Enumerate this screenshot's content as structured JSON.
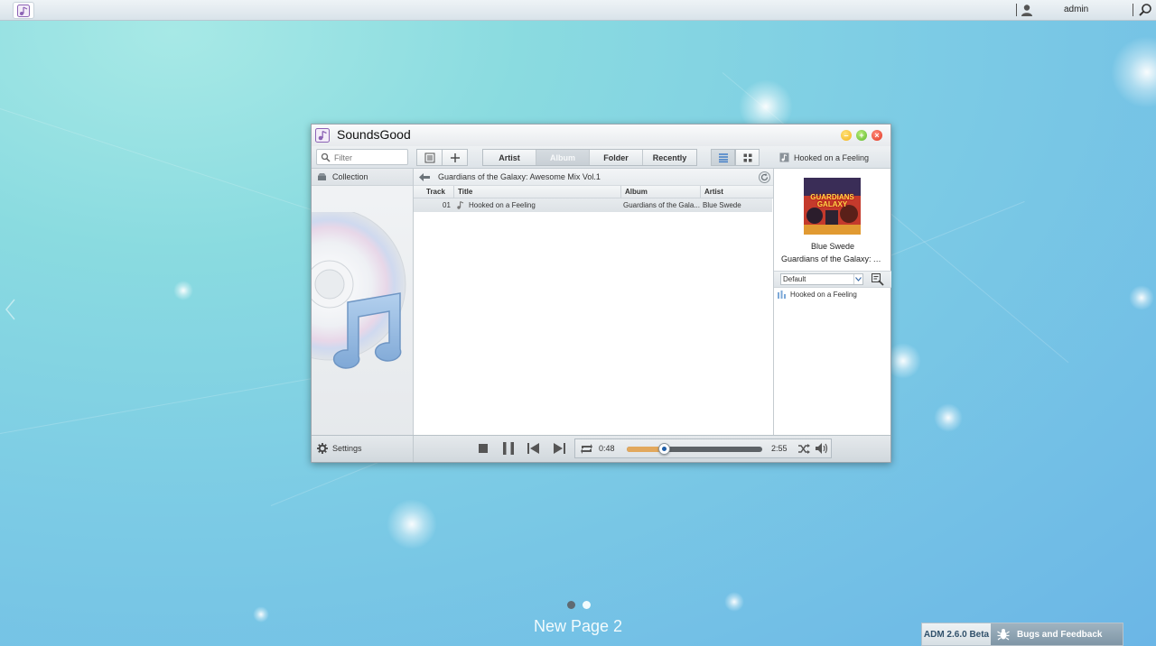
{
  "topbar": {
    "user_name": "admin"
  },
  "window": {
    "title": "SoundsGood",
    "filter_placeholder": "Filter",
    "tabs": [
      {
        "label": "Artist",
        "active": false
      },
      {
        "label": "Album",
        "active": true
      },
      {
        "label": "Folder",
        "active": false
      },
      {
        "label": "Recently",
        "active": false
      }
    ],
    "now_playing": "Hooked on a Feeling"
  },
  "sidebar": {
    "collection_label": "Collection",
    "settings_label": "Settings"
  },
  "main": {
    "breadcrumb": "Guardians of the Galaxy: Awesome Mix Vol.1",
    "columns": [
      "Track",
      "Title",
      "Album",
      "Artist"
    ],
    "rows": [
      {
        "track": "01",
        "title": "Hooked on a Feeling",
        "album": "Guardians of the Gala...",
        "artist": "Blue Swede"
      }
    ]
  },
  "right_panel": {
    "cover_text": "GUARDIANS GALAXY",
    "artist": "Blue Swede",
    "album": "Guardians of the Galaxy: A...",
    "playlist_select": "Default",
    "playlist_items": [
      "Hooked on a Feeling"
    ]
  },
  "player": {
    "current_time": "0:48",
    "total_time": "2:55",
    "progress": 0.27
  },
  "desktop": {
    "page_title": "New Page 2",
    "pages": 2,
    "active_page": 1,
    "version_label": "ADM 2.6.0 Beta",
    "feedback_label": "Bugs and Feedback"
  },
  "colors": {
    "accent_progress": "#e2a85d",
    "close": "#e1351f",
    "minimize": "#f3b21a",
    "maximize": "#5db92a"
  }
}
